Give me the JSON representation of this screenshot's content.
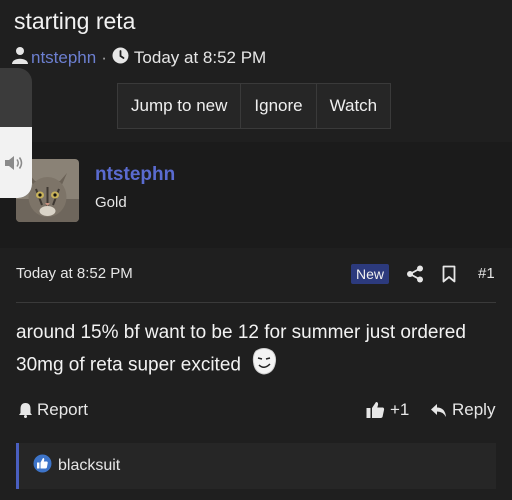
{
  "thread": {
    "title": "starting reta",
    "author": "ntstephn",
    "separator": "·",
    "timestamp": "Today at 8:52 PM"
  },
  "actions": {
    "jump_to_new": "Jump to new",
    "ignore": "Ignore",
    "watch": "Watch"
  },
  "volume": {
    "level": 0.55
  },
  "user": {
    "name": "ntstephn",
    "title": "Gold"
  },
  "post": {
    "timestamp": "Today at 8:52 PM",
    "badge": "New",
    "number": "#1",
    "body": "around 15% bf want to be 12 for summer just ordered 30mg of reta super excited",
    "report_label": "Report",
    "plus_one_label": "+1",
    "reply_label": "Reply"
  },
  "reactions": {
    "users": "blacksuit"
  },
  "colors": {
    "background": "#1f1f1f",
    "link": "#5a6bd0",
    "badge": "#2c3a7d",
    "reaction_accent": "#4a5fc0"
  }
}
